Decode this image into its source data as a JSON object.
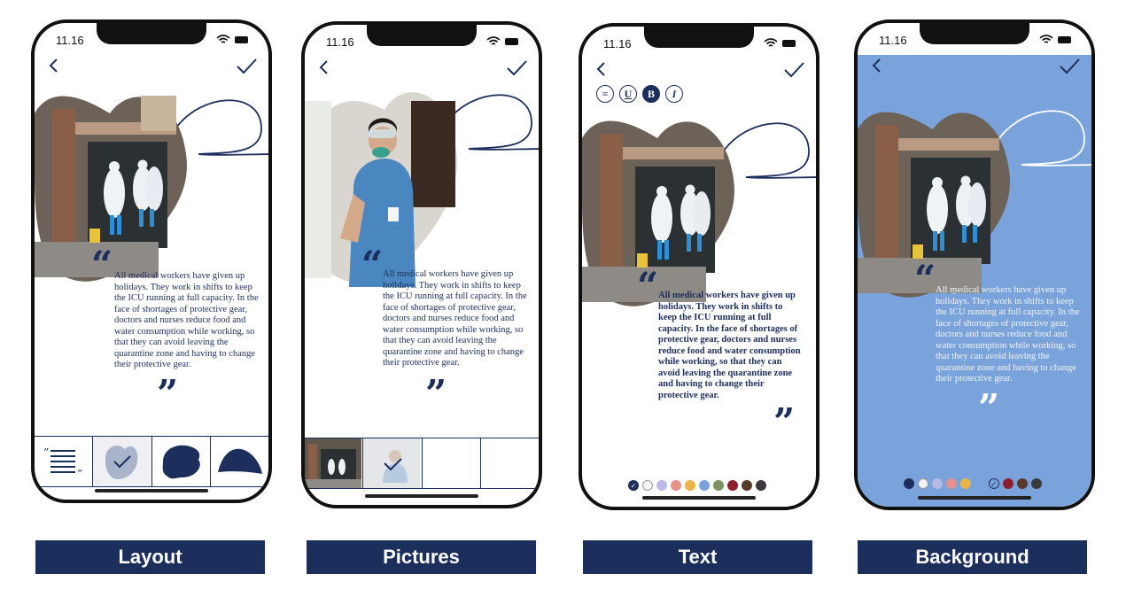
{
  "status_bar": {
    "time": "11.16"
  },
  "article": {
    "body": "All medical workers have given up holidays. They work in shifts to keep the ICU running at full capacity. In the face of shortages of protective gear, doctors and nurses reduce food and water consumption while working, so that they can avoid leaving the quarantine zone and having to change their protective gear.",
    "quote_open": "“",
    "quote_close": "”"
  },
  "screens": [
    {
      "caption": "Layout",
      "layout_options": [
        "text-only-layout",
        "small-blob-layout",
        "large-blob-layout",
        "wave-blob-layout"
      ],
      "selected_option": 1
    },
    {
      "caption": "Pictures",
      "picture_options": [
        "hospital-entrance-photo",
        "nurse-photo",
        "empty-slot",
        "empty-slot"
      ],
      "selected_option": 1
    },
    {
      "caption": "Text",
      "format_buttons": [
        {
          "name": "align",
          "glyph": "≡"
        },
        {
          "name": "underline",
          "glyph": "U"
        },
        {
          "name": "bold",
          "glyph": "B"
        },
        {
          "name": "italic",
          "glyph": "I"
        }
      ],
      "active_format": "bold",
      "selected_color_index": 0
    },
    {
      "caption": "Background",
      "background_color": "#7aa3dc",
      "selected_color_index": 6
    }
  ],
  "palette": [
    "#1c2e5c",
    "#f2f2f2",
    "#b9b9e6",
    "#e6918a",
    "#ecb24a",
    "#7aa3dc",
    "#7d9263",
    "#8c1f2e",
    "#5b3a29",
    "#3a3a3a"
  ],
  "colors": {
    "navy": "#1c2e5c",
    "caption_bg": "#1c2e5c",
    "background_blue": "#7aa3dc"
  }
}
